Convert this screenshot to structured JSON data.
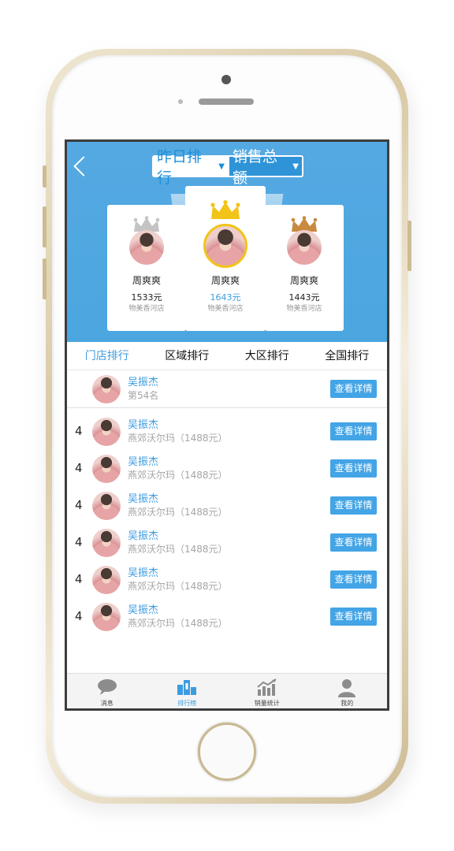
{
  "header": {
    "period_label": "昨日排行",
    "metric_label": "销售总额"
  },
  "podium": [
    {
      "place": 2,
      "name": "周爽爽",
      "amount": "1533元",
      "store": "物美香河店"
    },
    {
      "place": 1,
      "name": "周爽爽",
      "amount": "1643元",
      "store": "物美香河店"
    },
    {
      "place": 3,
      "name": "周爽爽",
      "amount": "1443元",
      "store": "物美香河店"
    }
  ],
  "tabs": [
    "门店排行",
    "区域排行",
    "大区排行",
    "全国排行"
  ],
  "self": {
    "name": "吴振杰",
    "rank_text": "第54名",
    "button": "查看详情"
  },
  "rows": [
    {
      "rank": "4",
      "name": "吴振杰",
      "sub": "燕郊沃尔玛（1488元）",
      "button": "查看详情"
    },
    {
      "rank": "4",
      "name": "吴振杰",
      "sub": "燕郊沃尔玛（1488元）",
      "button": "查看详情"
    },
    {
      "rank": "4",
      "name": "吴振杰",
      "sub": "燕郊沃尔玛（1488元）",
      "button": "查看详情"
    },
    {
      "rank": "4",
      "name": "吴振杰",
      "sub": "燕郊沃尔玛（1488元）",
      "button": "查看详情"
    },
    {
      "rank": "4",
      "name": "吴振杰",
      "sub": "燕郊沃尔玛（1488元）",
      "button": "查看详情"
    },
    {
      "rank": "4",
      "name": "吴振杰",
      "sub": "燕郊沃尔玛（1488元）",
      "button": "查看详情"
    }
  ],
  "tabbar": [
    {
      "label": "消息",
      "icon": "chat-bubble-icon"
    },
    {
      "label": "排行榜",
      "icon": "podium-icon"
    },
    {
      "label": "销量统计",
      "icon": "chart-icon"
    },
    {
      "label": "我的",
      "icon": "person-icon"
    }
  ],
  "colors": {
    "accent": "#3d9ce0",
    "header_bg": "#4ba6e0",
    "gold": "#f2c418",
    "silver": "#bfbfbf",
    "bronze": "#c98a3f"
  }
}
